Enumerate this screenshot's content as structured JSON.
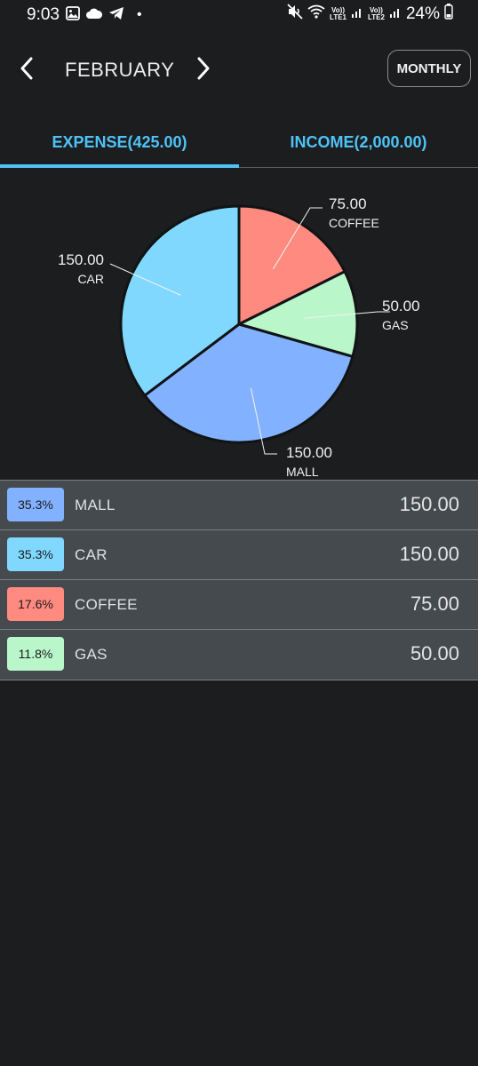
{
  "status_bar": {
    "time": "9:03",
    "battery": "24%",
    "lte1": "LTE1",
    "lte2": "LTE2",
    "volte": "Vo))",
    "dot": "•"
  },
  "header": {
    "month": "FEBRUARY",
    "mode_button": "MONTHLY"
  },
  "tabs": [
    {
      "label": "EXPENSE(425.00)",
      "selected": true
    },
    {
      "label": "INCOME(2,000.00)",
      "selected": false
    }
  ],
  "colors": {
    "accent": "#4fc3f7",
    "mall": "#82b1ff",
    "car": "#80d8ff",
    "coffee": "#ff8a80",
    "gas": "#b9f6ca"
  },
  "chart_data": {
    "type": "pie",
    "slices": [
      {
        "label": "COFFEE",
        "value": 75.0,
        "value_label": "75.00",
        "color": "#ff8a80"
      },
      {
        "label": "GAS",
        "value": 50.0,
        "value_label": "50.00",
        "color": "#b9f6ca"
      },
      {
        "label": "MALL",
        "value": 150.0,
        "value_label": "150.00",
        "color": "#82b1ff"
      },
      {
        "label": "CAR",
        "value": 150.0,
        "value_label": "150.00",
        "color": "#80d8ff"
      }
    ],
    "start_angle_deg": 0,
    "direction": "clockwise"
  },
  "list": [
    {
      "percent": "35.3%",
      "name": "MALL",
      "amount": "150.00",
      "color": "#82b1ff"
    },
    {
      "percent": "35.3%",
      "name": "CAR",
      "amount": "150.00",
      "color": "#80d8ff"
    },
    {
      "percent": "17.6%",
      "name": "COFFEE",
      "amount": "75.00",
      "color": "#ff8a80"
    },
    {
      "percent": "11.8%",
      "name": "GAS",
      "amount": "50.00",
      "color": "#b9f6ca"
    }
  ]
}
